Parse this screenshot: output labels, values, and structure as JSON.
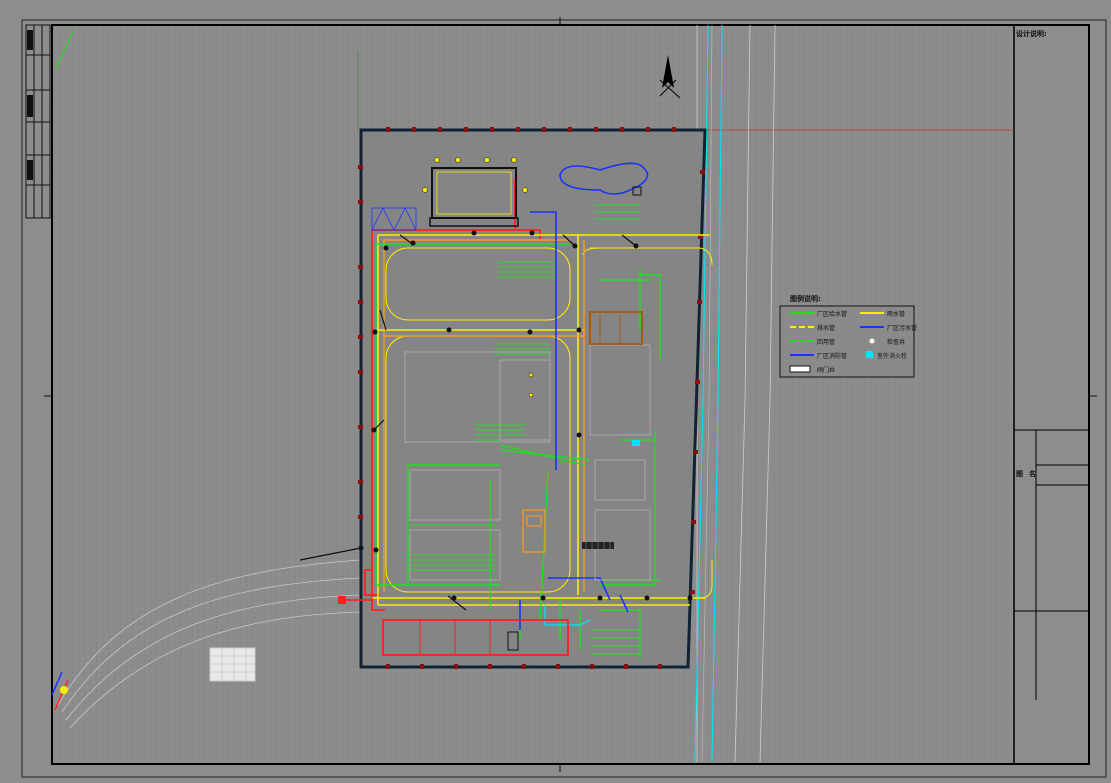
{
  "drawing": {
    "notes_title": "设计说明:",
    "drawing_name_label": "图名"
  },
  "legend": {
    "title": "图例说明:",
    "items": [
      {
        "label": "厂区给水管",
        "color": "#22dd22",
        "style": "solid"
      },
      {
        "label": "雨水管",
        "color": "#ffee00",
        "style": "solid"
      },
      {
        "label": "排水管",
        "color": "#ffee00",
        "style": "dashed"
      },
      {
        "label": "厂区污水管",
        "color": "#1a33ff",
        "style": "solid"
      },
      {
        "label": "回用管",
        "color": "#22dd22",
        "style": "dashed"
      },
      {
        "label": "检查井",
        "color": "#ffffff",
        "style": "none"
      },
      {
        "label": "厂区消防管",
        "color": "#1a33ff",
        "style": "solid"
      },
      {
        "label": "室外消火栓",
        "color": "#00e5ff",
        "style": "box"
      },
      {
        "label": "阀门井",
        "color": "#ffffff",
        "style": "box"
      }
    ]
  },
  "colors": {
    "background": "#8a8a8a",
    "frame": "#000000",
    "water_supply": "#22dd22",
    "rain": "#ffee00",
    "sewage": "#1a33ff",
    "fire": "#ff2020",
    "road": "#00e5ff"
  }
}
